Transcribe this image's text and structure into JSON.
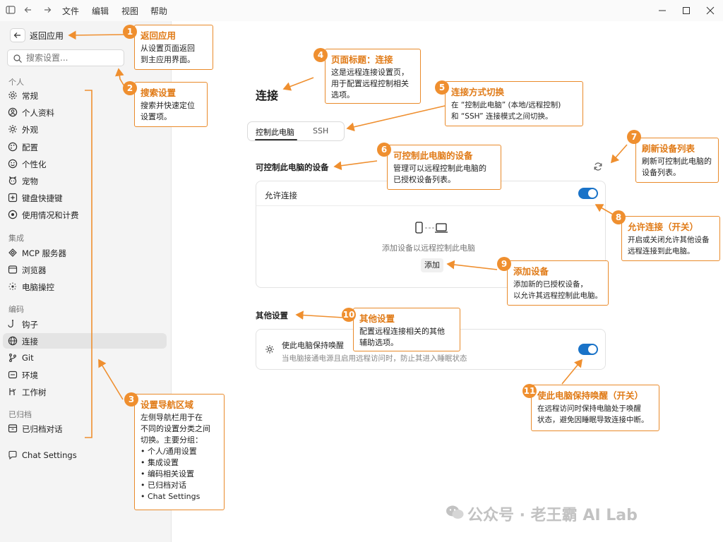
{
  "menu": [
    "文件",
    "编辑",
    "视图",
    "帮助"
  ],
  "sidebar": {
    "back_label": "返回应用",
    "search_placeholder": "搜索设置...",
    "groups": {
      "personal": "个人",
      "integration": "集成",
      "coding": "编码",
      "archived": "已归档"
    },
    "items": [
      {
        "label": "常规",
        "icon": "gear-icon"
      },
      {
        "label": "个人资料",
        "icon": "user-circle-icon"
      },
      {
        "label": "外观",
        "icon": "sun-icon"
      },
      {
        "label": "配置",
        "icon": "palette-icon"
      },
      {
        "label": "个性化",
        "icon": "smile-icon"
      },
      {
        "label": "宠物",
        "icon": "pet-icon"
      },
      {
        "label": "键盘快捷键",
        "icon": "keyboard-plus-icon"
      },
      {
        "label": "使用情况和计费",
        "icon": "usage-icon"
      },
      {
        "label": "MCP 服务器",
        "icon": "mcp-icon"
      },
      {
        "label": "浏览器",
        "icon": "browser-icon"
      },
      {
        "label": "电脑操控",
        "icon": "computer-control-icon"
      },
      {
        "label": "钩子",
        "icon": "hook-icon"
      },
      {
        "label": "连接",
        "icon": "globe-icon"
      },
      {
        "label": "Git",
        "icon": "git-branch-icon"
      },
      {
        "label": "环境",
        "icon": "environment-icon"
      },
      {
        "label": "工作树",
        "icon": "worktree-icon"
      },
      {
        "label": "已归档对话",
        "icon": "archive-icon"
      },
      {
        "label": "Chat Settings",
        "icon": "chat-icon"
      }
    ]
  },
  "main": {
    "title": "连接",
    "tabs": [
      "控制此电脑",
      "SSH"
    ],
    "devices_section": "可控制此电脑的设备",
    "allow_label": "允许连接",
    "allow_on": true,
    "empty_text": "添加设备以远程控制此电脑",
    "add_label": "添加",
    "other_section": "其他设置",
    "keep_awake_label": "使此电脑保持唤醒",
    "keep_awake_desc": "当电脑接通电源且启用远程访问时，防止其进入睡眠状态",
    "keep_awake_on": true
  },
  "annotations": [
    {
      "num": "1",
      "title": "返回应用",
      "desc": [
        "从设置页面返回",
        "到主应用界面。"
      ]
    },
    {
      "num": "2",
      "title": "搜索设置",
      "desc": [
        "搜索并快速定位",
        "设置项。"
      ]
    },
    {
      "num": "3",
      "title": "设置导航区域",
      "desc": [
        "左侧导航栏用于在",
        "不同的设置分类之间",
        "切换。主要分组：",
        "• 个人/通用设置",
        "• 集成设置",
        "• 编码相关设置",
        "• 已归档对话",
        "• Chat Settings"
      ]
    },
    {
      "num": "4",
      "title": "页面标题：连接",
      "desc": [
        "这是远程连接设置页，",
        "用于配置远程控制相关",
        "选项。"
      ]
    },
    {
      "num": "5",
      "title": "连接方式切换",
      "desc": [
        "在 “控制此电脑” (本地/远程控制)",
        "和 “SSH” 连接模式之间切换。"
      ]
    },
    {
      "num": "6",
      "title": "可控制此电脑的设备",
      "desc": [
        "管理可以远程控制此电脑的",
        "已授权设备列表。"
      ]
    },
    {
      "num": "7",
      "title": "刷新设备列表",
      "desc": [
        "刷新可控制此电脑的",
        "设备列表。"
      ]
    },
    {
      "num": "8",
      "title": "允许连接（开关）",
      "desc": [
        "开启或关闭允许其他设备",
        "远程连接到此电脑。"
      ]
    },
    {
      "num": "9",
      "title": "添加设备",
      "desc": [
        "添加新的已授权设备，",
        "以允许其远程控制此电脑。"
      ]
    },
    {
      "num": "10",
      "title": "其他设置",
      "desc": [
        "配置远程连接相关的其他",
        "辅助选项。"
      ]
    },
    {
      "num": "11",
      "title": "使此电脑保持唤醒（开关）",
      "desc": [
        "在远程访问时保持电脑处于唤醒",
        "状态，避免因睡眠导致连接中断。"
      ]
    }
  ],
  "watermark": "公众号 · 老王霸 AI Lab",
  "colors": {
    "accent": "#1a73c8",
    "annotation": "#ef8f2f"
  }
}
